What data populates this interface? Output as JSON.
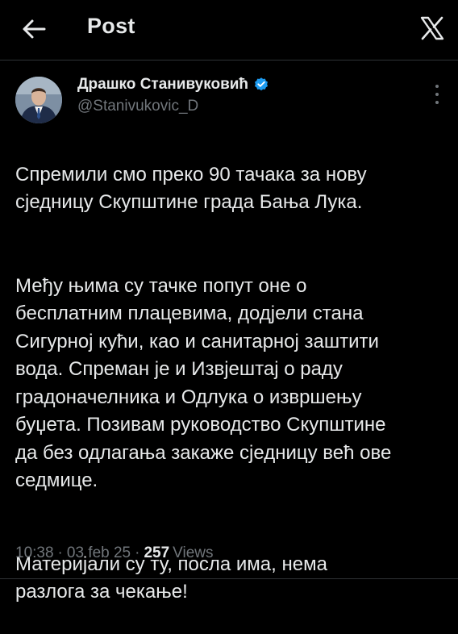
{
  "header": {
    "title": "Post",
    "back_icon": "arrow-left-icon",
    "logo_icon": "x-logo-icon"
  },
  "post": {
    "author": {
      "name": "Драшко Станивуковић",
      "handle": "@Stanivukovic_D",
      "verified": true
    },
    "paragraphs": [
      "Спремили смо преко 90 тачака за нову\nсједницу Скупштине града Бања Лука.",
      "Међу њима су тачке попут оне о\nбесплатним плацевима, додјели стана\nСигурној кући, као и санитарној заштити\nвода. Спреман је и Извјештај о раду\nградоначелника и Одлука о извршењу\nбуџета. Позивам руководство Скупштине\nда без одлагања закаже сједницу већ ове\nседмице.",
      "Материјали су ту, посла има, нема\nразлога за чекање!"
    ],
    "time": "10:38",
    "separator": "·",
    "date": "03 feb 25",
    "views_count": "257",
    "views_label": "Views"
  },
  "colors": {
    "background": "#000000",
    "text_primary": "#e7e9ea",
    "text_secondary": "#71767b",
    "verified": "#1d9bf0",
    "divider": "#2f3336"
  }
}
